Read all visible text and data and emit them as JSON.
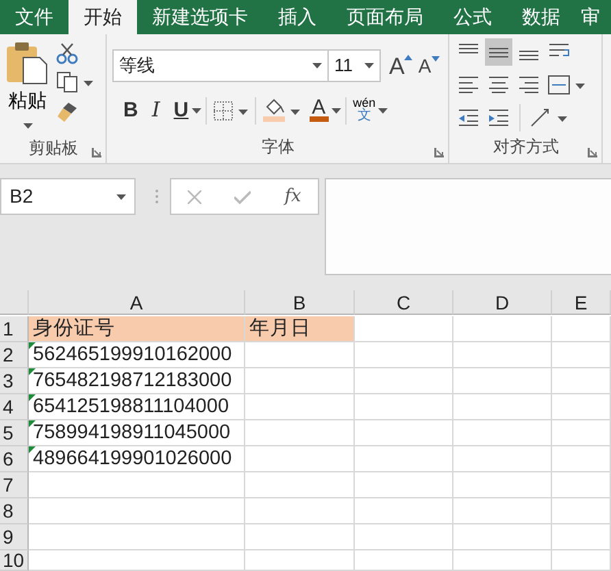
{
  "tabs": [
    {
      "label": "文件",
      "selected": false
    },
    {
      "label": "开始",
      "selected": true
    },
    {
      "label": "新建选项卡",
      "selected": false
    },
    {
      "label": "插入",
      "selected": false
    },
    {
      "label": "页面布局",
      "selected": false
    },
    {
      "label": "公式",
      "selected": false
    },
    {
      "label": "数据",
      "selected": false
    },
    {
      "label": "审",
      "selected": false
    }
  ],
  "clipboard": {
    "paste_label": "粘贴",
    "group_label": "剪贴板"
  },
  "font": {
    "font_name": "等线",
    "font_size": "11",
    "grow_label": "A",
    "shrink_label": "A",
    "bold_label": "B",
    "italic_label": "I",
    "underline_label": "U",
    "font_color_label": "A",
    "phonetic_top": "wén",
    "phonetic_bottom": "文",
    "group_label": "字体"
  },
  "alignment": {
    "group_label": "对齐方式",
    "buttons": [
      {
        "kind": "top",
        "selected": false
      },
      {
        "kind": "middle",
        "selected": true
      },
      {
        "kind": "bottom",
        "selected": false
      },
      {
        "kind": "wrap",
        "selected": false
      },
      {
        "kind": "left",
        "selected": false
      },
      {
        "kind": "center",
        "selected": false
      },
      {
        "kind": "right",
        "selected": false
      },
      {
        "kind": "merge",
        "selected": false
      },
      {
        "kind": "outdent",
        "selected": false
      },
      {
        "kind": "indent",
        "selected": false
      },
      {
        "kind": "orientation",
        "selected": false
      }
    ]
  },
  "name_box": "B2",
  "fx_label": "fx",
  "sheet": {
    "columns": [
      "A",
      "B",
      "C",
      "D",
      "E"
    ],
    "rows": [
      {
        "header": "1",
        "highlighted": true,
        "cells": [
          {
            "text": "身份证号",
            "flagged": false
          },
          {
            "text": "年月日",
            "flagged": false
          }
        ]
      },
      {
        "header": "2",
        "highlighted": false,
        "cells": [
          {
            "text": "562465199910162000",
            "flagged": true
          }
        ]
      },
      {
        "header": "3",
        "highlighted": false,
        "cells": [
          {
            "text": "765482198712183000",
            "flagged": true
          }
        ]
      },
      {
        "header": "4",
        "highlighted": false,
        "cells": [
          {
            "text": "654125198811104000",
            "flagged": true
          }
        ]
      },
      {
        "header": "5",
        "highlighted": false,
        "cells": [
          {
            "text": "758994198911045000",
            "flagged": true
          }
        ]
      },
      {
        "header": "6",
        "highlighted": false,
        "cells": [
          {
            "text": "489664199901026000",
            "flagged": true
          }
        ]
      },
      {
        "header": "7",
        "highlighted": false
      },
      {
        "header": "8",
        "highlighted": false
      },
      {
        "header": "9",
        "highlighted": false
      },
      {
        "header": "10",
        "highlighted": false
      }
    ]
  }
}
